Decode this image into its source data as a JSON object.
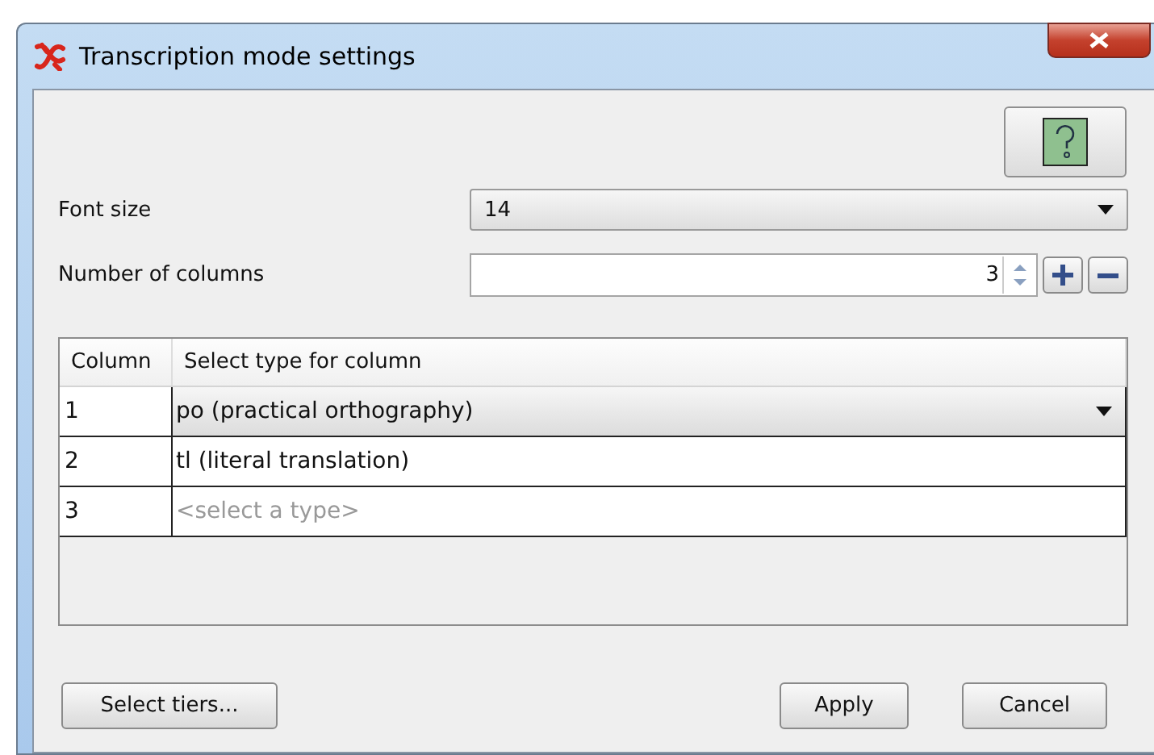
{
  "window": {
    "title": "Transcription mode settings"
  },
  "font_size": {
    "label": "Font size",
    "value": "14"
  },
  "number_of_columns": {
    "label": "Number of columns",
    "value": "3"
  },
  "table": {
    "columns": [
      "Column",
      "Select type for column"
    ],
    "rows": [
      {
        "column": "1",
        "type": "po (practical orthography)",
        "kind": "dropdown"
      },
      {
        "column": "2",
        "type": "tl (literal translation)",
        "kind": "text"
      },
      {
        "column": "3",
        "type": "<select a type>",
        "kind": "placeholder"
      }
    ]
  },
  "buttons": {
    "left": "Select tiers...",
    "apply": "Apply",
    "cancel": "Cancel"
  }
}
